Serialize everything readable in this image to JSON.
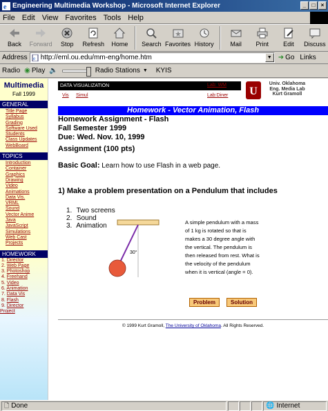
{
  "window": {
    "title": "Engineering Multimedia Workshop - Microsoft Internet Explorer"
  },
  "menu": [
    "File",
    "Edit",
    "View",
    "Favorites",
    "Tools",
    "Help"
  ],
  "toolbar": [
    {
      "label": "Back",
      "icon": "back-arrow-icon"
    },
    {
      "label": "Forward",
      "icon": "forward-arrow-icon"
    },
    {
      "label": "Stop",
      "icon": "stop-icon"
    },
    {
      "label": "Refresh",
      "icon": "refresh-icon"
    },
    {
      "label": "Home",
      "icon": "home-icon"
    },
    {
      "label": "Search",
      "icon": "search-icon"
    },
    {
      "label": "Favorites",
      "icon": "favorites-icon"
    },
    {
      "label": "History",
      "icon": "history-icon"
    },
    {
      "label": "Mail",
      "icon": "mail-icon"
    },
    {
      "label": "Print",
      "icon": "print-icon"
    },
    {
      "label": "Edit",
      "icon": "edit-icon"
    },
    {
      "label": "Discuss",
      "icon": "discuss-icon"
    }
  ],
  "address": {
    "label": "Address",
    "url": "http://eml.ou.edu/mm-eng/home.htm",
    "go": "Go",
    "links": "Links"
  },
  "radiobar": {
    "radio": "Radio",
    "play": "Play",
    "stations": "Radio Stations",
    "station_name": "KYIS"
  },
  "sidebar": {
    "title": "Multimedia",
    "subtitle": "Fall 1999",
    "general_heading": "GENERAL",
    "general": [
      "Title Page",
      "Syllabus",
      "Grading",
      "Software Used",
      "Students",
      "Class Updates",
      "WebBoard"
    ],
    "topics_heading": "TOPICS",
    "topics": [
      "Introduction",
      "Container",
      "Graphics",
      "Drawing",
      "Video",
      "Animations",
      "Data Vis.",
      "VRML",
      "Sound",
      "Vector Anime",
      "Java",
      "JavaScript",
      "Simulations",
      "Web Cast",
      "Projects"
    ],
    "homework_heading": "HOMEWORK",
    "homework": [
      {
        "num": "1.",
        "label": "Director"
      },
      {
        "num": "2.",
        "label": "Web Page"
      },
      {
        "num": "3.",
        "label": "Photoshop"
      },
      {
        "num": "4.",
        "label": "Freehand"
      },
      {
        "num": "5.",
        "label": "Video"
      },
      {
        "num": "6.",
        "label": "Animation"
      },
      {
        "num": "7.",
        "label": "Data Vis"
      },
      {
        "num": "8.",
        "label": "Flash"
      },
      {
        "num": "9.",
        "label": "Director"
      }
    ],
    "project": "Project"
  },
  "header": {
    "section": "DATA VISUALIZATION",
    "link_vis": "Vis",
    "link_simul": "Simul",
    "lab_wm": "Lab: WM",
    "lab_diner": "Lab:Diner",
    "ou_lines": [
      "Univ. Oklahoma",
      "Eng. Media Lab",
      "Kurt Gramoll"
    ]
  },
  "banner": "Homework - Vector Animation, Flash",
  "assignment": {
    "title": "Homework Assignment - Flash",
    "semester": "Fall Semester 1999",
    "due": "Due: Wed. Nov. 10, 1999",
    "points": "Assignment (100 pts)",
    "goal_label": "Basic Goal:",
    "goal_text": " Learn how to use Flash in a web page.",
    "task": "1) Make a problem presentation on a Pendulum that includes",
    "items": [
      {
        "num": "1.",
        "text": "Two screens"
      },
      {
        "num": "2.",
        "text": "Sound"
      },
      {
        "num": "3.",
        "text": "Animation"
      }
    ],
    "angle_label": "30°",
    "description": "A simple pendulum with a mass of 1 kg is rotated so that is makes a 30 degree angle with the vertical. The pendulum is then released from rest.  What is the velocity of the pendulum when it is vertical (angle = 0).",
    "problem_button": "Problem",
    "solution_button": "Solution"
  },
  "footer": {
    "prefix": "© 1999 Kurt Gramoll, ",
    "link": "The University of Oklahoma",
    "suffix": ". All Rights Reserved."
  },
  "status": {
    "left": "Done",
    "zone": "Internet"
  }
}
